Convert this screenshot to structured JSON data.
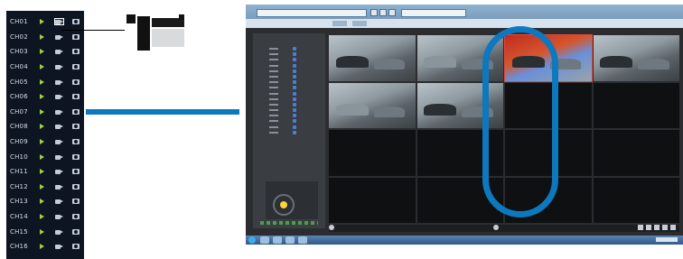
{
  "channels": [
    {
      "label": "CH01"
    },
    {
      "label": "CH02"
    },
    {
      "label": "CH03"
    },
    {
      "label": "CH04"
    },
    {
      "label": "CH05"
    },
    {
      "label": "CH06"
    },
    {
      "label": "CH07"
    },
    {
      "label": "CH08"
    },
    {
      "label": "CH09"
    },
    {
      "label": "CH10"
    },
    {
      "label": "CH11"
    },
    {
      "label": "CH12"
    },
    {
      "label": "CH13"
    },
    {
      "label": "CH14"
    },
    {
      "label": "CH15"
    },
    {
      "label": "CH16"
    }
  ],
  "colors": {
    "accent_blue": "#0e78be",
    "panel_bg": "#0d1522",
    "play_green": "#9fd23a",
    "selected_red": "#e14b3a"
  },
  "icons": {
    "play": "play-icon",
    "record": "record-video-icon",
    "snapshot": "camera-snapshot-icon",
    "cursor": "hand-cursor-icon"
  }
}
